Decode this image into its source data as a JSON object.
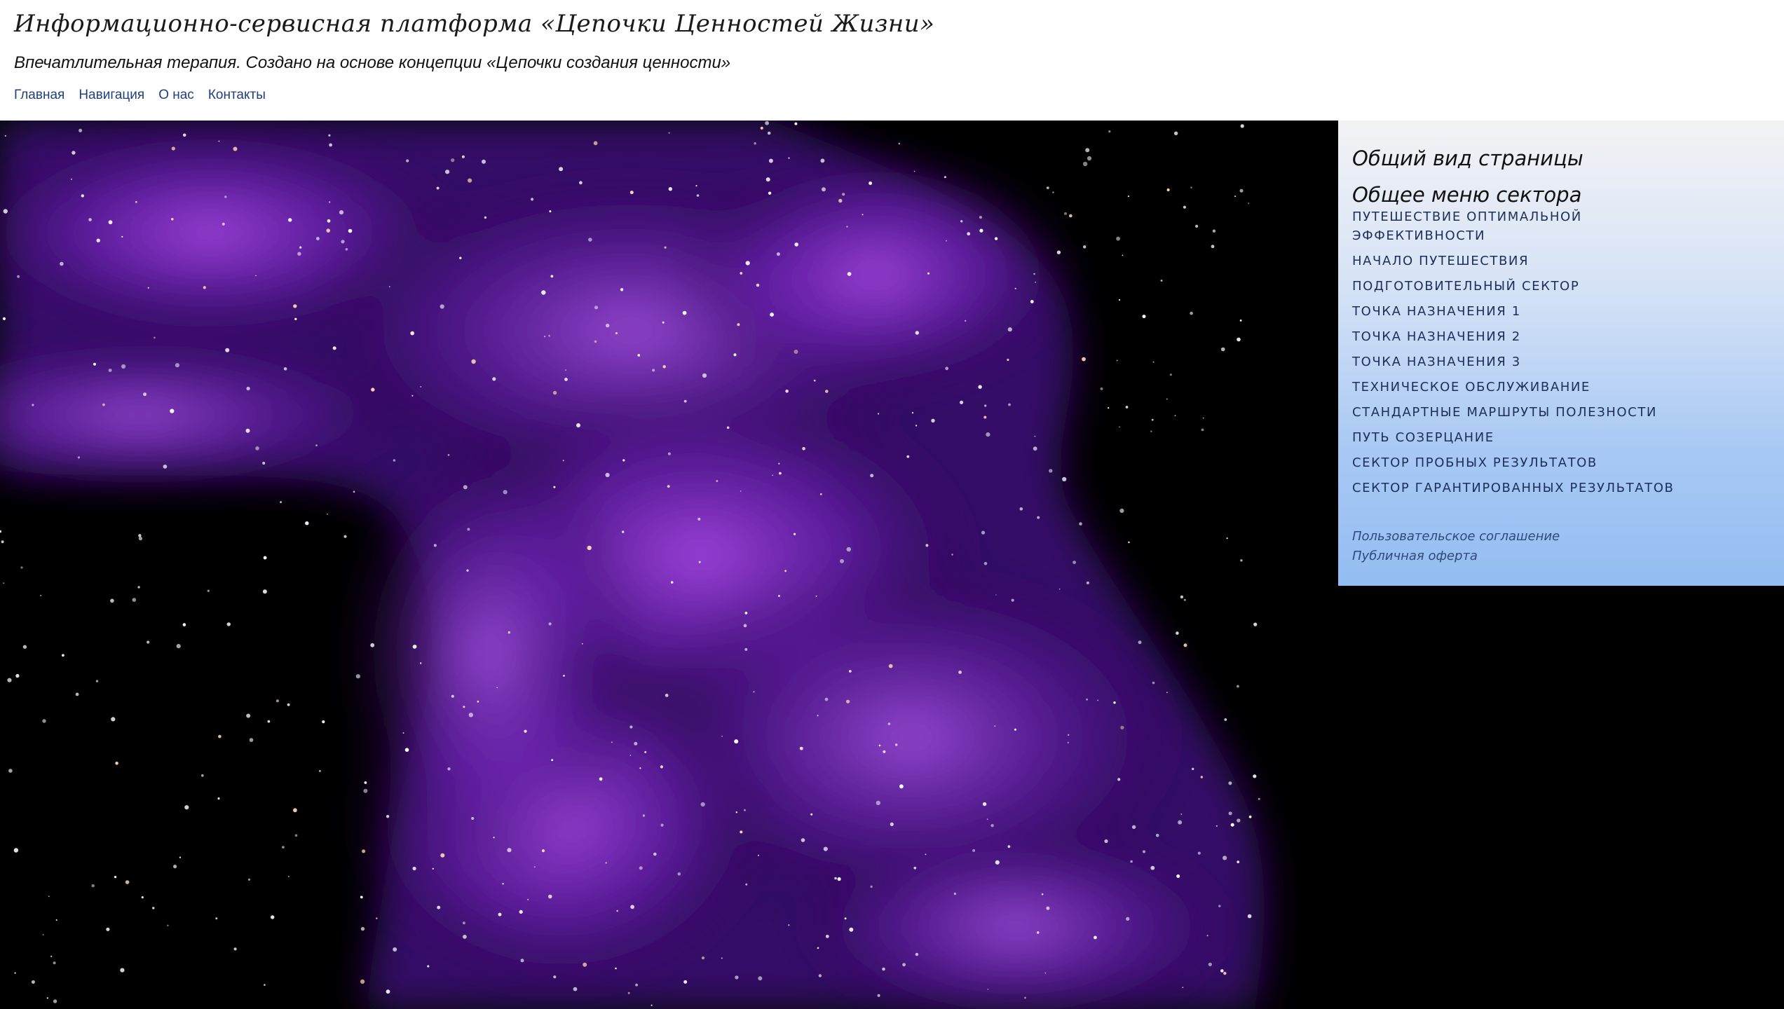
{
  "header": {
    "site_title": "Информационно-сервисная платформа «Цепочки Ценностей Жизни»",
    "subtitle": "Впечатлительная терапия. Создано на основе концепции «Цепочки создания ценности»",
    "nav": [
      "Главная",
      "Навигация",
      "О нас",
      "Контакты"
    ]
  },
  "sidebar": {
    "page_view_heading": "Общий вид страницы",
    "menu_heading": "Общее меню сектора",
    "menu_items": [
      "Путешествие оптимальной эффективности",
      "Начало путешествия",
      "Подготовительный сектор",
      "Точка назначения 1",
      "Точка назначения 2",
      "Точка назначения 3",
      "Техническое обслуживание",
      "Стандартные маршруты полезности",
      "Путь созерцание",
      "Сектор пробных результатов",
      "Сектор гарантированных результатов"
    ],
    "legal_links": [
      "Пользовательское соглашение",
      "Публичная оферта"
    ]
  },
  "hero": {
    "background_color": "#000000",
    "nebula_color": "#8a2be2"
  }
}
